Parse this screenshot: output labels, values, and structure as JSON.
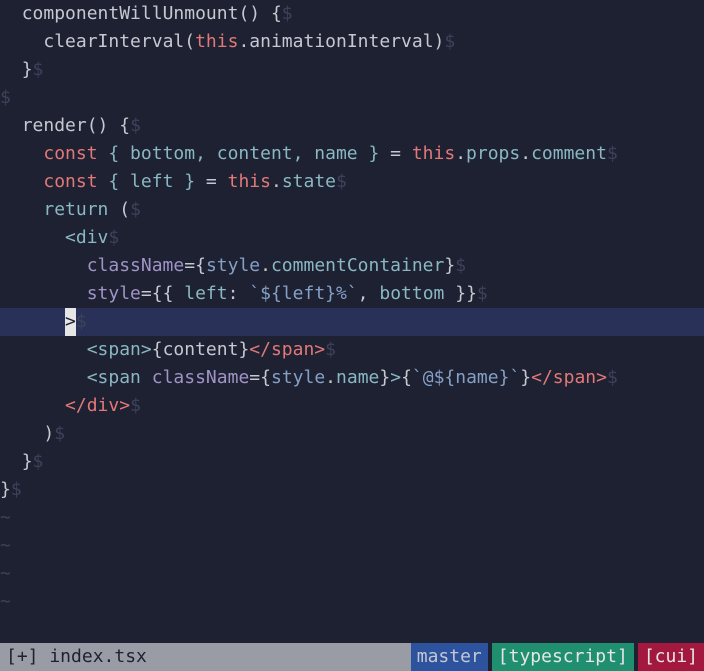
{
  "eol": "$",
  "tilde": "~",
  "cursor_char": ">",
  "code": {
    "l1": {
      "indent": "  ",
      "name": "componentWillUnmount",
      "parens": "() {"
    },
    "l2": {
      "indent": "    ",
      "call": "clearInterval",
      "open": "(",
      "this": "this",
      "dot": ".",
      "prop": "animationInterval",
      "close": ")"
    },
    "l3": {
      "indent": "  ",
      "brace": "}"
    },
    "l4": {},
    "l5": {
      "indent": "  ",
      "name": "render",
      "parens": "() {"
    },
    "l6": {
      "indent": "    ",
      "kw": "const",
      "destruct": " { bottom, content, name } ",
      "eq": "= ",
      "this": "this",
      "dot1": ".",
      "p1": "props",
      "dot2": ".",
      "p2": "comment"
    },
    "l7": {
      "indent": "    ",
      "kw": "const",
      "destruct": " { left } ",
      "eq": "= ",
      "this": "this",
      "dot1": ".",
      "p1": "state"
    },
    "l8": {
      "indent": "    ",
      "kw": "return",
      "paren": " ("
    },
    "l9": {
      "indent": "      ",
      "lt": "<",
      "tag": "div"
    },
    "l10": {
      "indent": "        ",
      "attr": "className",
      "eq": "=",
      "ob": "{",
      "obj": "style",
      "dot": ".",
      "prop": "commentContainer",
      "cb": "}"
    },
    "l11": {
      "indent": "        ",
      "attr": "style",
      "eq": "=",
      "ob": "{{ ",
      "k1": "left",
      "col1": ": ",
      "tpl": "`${left}%`",
      "com": ", ",
      "k2": "bottom",
      "cb": " }}"
    },
    "l12": {
      "indent": "      "
    },
    "l13": {
      "indent": "        ",
      "open": "<span>",
      "expr_o": "{",
      "var": "content",
      "expr_c": "}",
      "close": "</span>"
    },
    "l14": {
      "indent": "        ",
      "open_lt": "<",
      "open_tag": "span",
      "sp": " ",
      "attr": "className",
      "eq": "=",
      "ob": "{",
      "obj": "style",
      "dot": ".",
      "prop": "name",
      "cb": "}",
      "gt": ">",
      "expr_o": "{",
      "tpl": "`@${name}`",
      "expr_c": "}",
      "close": "</span>"
    },
    "l15": {
      "indent": "      ",
      "close": "</div>"
    },
    "l16": {
      "indent": "    ",
      "paren": ")"
    },
    "l17": {
      "indent": "  ",
      "brace": "}"
    },
    "l18": {
      "brace": "}"
    }
  },
  "status": {
    "file": "[+] index.tsx",
    "branch": "master",
    "lang": "[typescript]",
    "mode": "[cui]"
  }
}
